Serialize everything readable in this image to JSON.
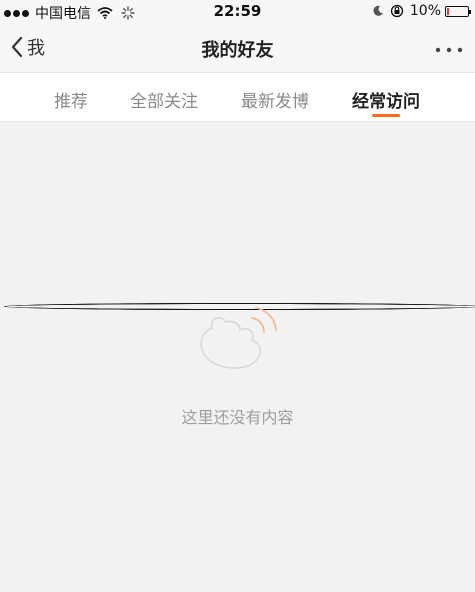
{
  "status_bar": {
    "carrier": "中国电信",
    "time": "22:59",
    "battery": "10%",
    "battery_level": 0.1
  },
  "nav": {
    "back_label": "我",
    "title": "我的好友"
  },
  "tabs": [
    {
      "label": "推荐"
    },
    {
      "label": "全部关注"
    },
    {
      "label": "最新发博"
    },
    {
      "label": "经常访问"
    }
  ],
  "active_tab": 3,
  "empty_state": {
    "message": "这里还没有内容"
  },
  "colors": {
    "accent": "#ff6a1a",
    "battery_low": "#e53935"
  }
}
